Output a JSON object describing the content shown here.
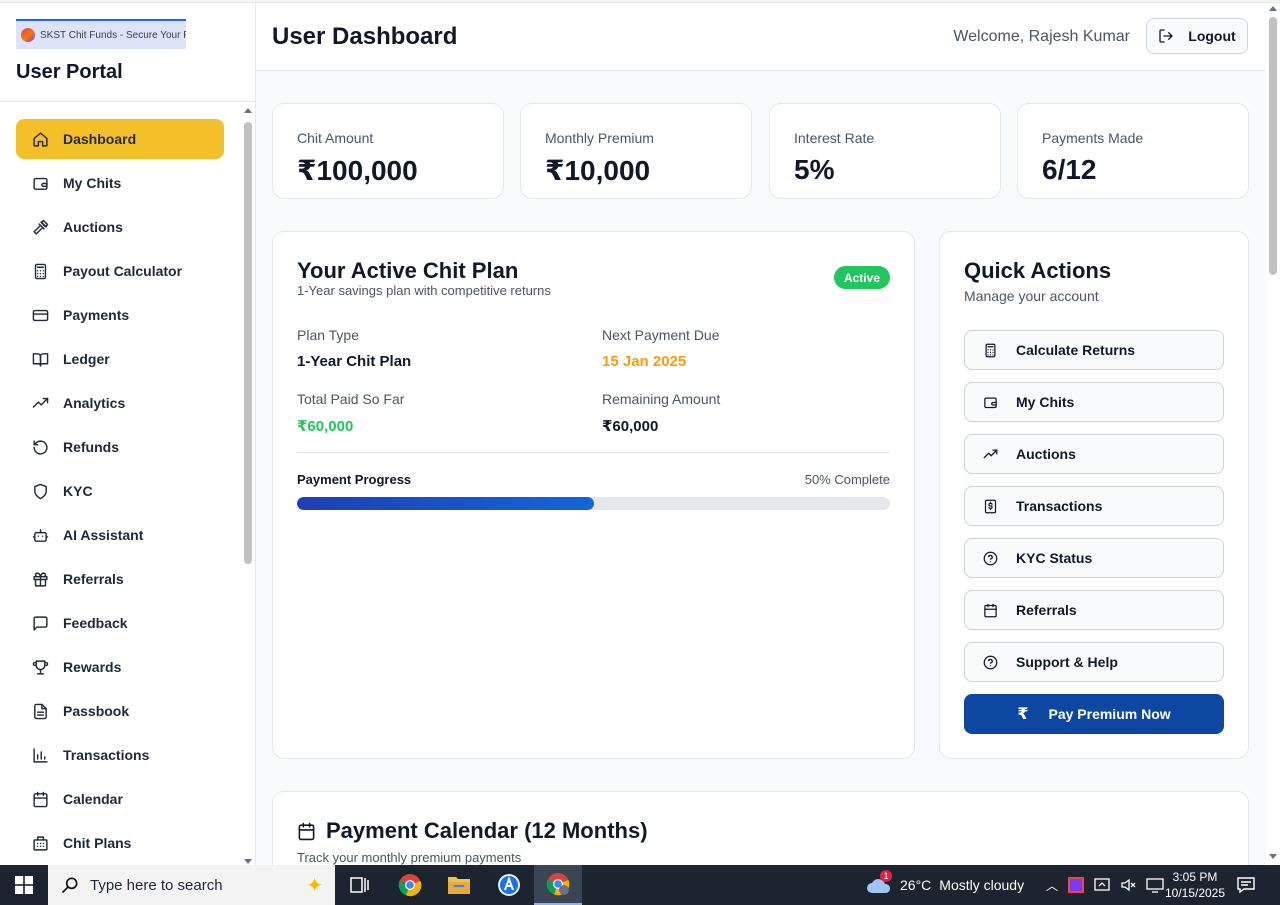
{
  "browser_tab": {
    "title": "SKST Chit Funds - Secure Your F"
  },
  "sidebar": {
    "portal_title": "User Portal",
    "items": [
      {
        "label": "Dashboard",
        "icon": "home-icon",
        "active": true
      },
      {
        "label": "My Chits",
        "icon": "wallet-icon"
      },
      {
        "label": "Auctions",
        "icon": "gavel-icon"
      },
      {
        "label": "Payout Calculator",
        "icon": "calculator-icon"
      },
      {
        "label": "Payments",
        "icon": "credit-card-icon"
      },
      {
        "label": "Ledger",
        "icon": "book-open-icon"
      },
      {
        "label": "Analytics",
        "icon": "trending-up-icon"
      },
      {
        "label": "Refunds",
        "icon": "rotate-ccw-icon"
      },
      {
        "label": "KYC",
        "icon": "shield-icon"
      },
      {
        "label": "AI Assistant",
        "icon": "bot-icon"
      },
      {
        "label": "Referrals",
        "icon": "gift-icon"
      },
      {
        "label": "Feedback",
        "icon": "message-square-icon"
      },
      {
        "label": "Rewards",
        "icon": "trophy-icon"
      },
      {
        "label": "Passbook",
        "icon": "file-text-icon"
      },
      {
        "label": "Transactions",
        "icon": "bar-chart-icon"
      },
      {
        "label": "Calendar",
        "icon": "calendar-icon"
      },
      {
        "label": "Chit Plans",
        "icon": "building-icon"
      }
    ]
  },
  "header": {
    "title": "User Dashboard",
    "welcome": "Welcome, Rajesh Kumar",
    "logout_label": "Logout"
  },
  "stats": [
    {
      "label": "Chit Amount",
      "value": "₹100,000"
    },
    {
      "label": "Monthly Premium",
      "value": "₹10,000"
    },
    {
      "label": "Interest Rate",
      "value": "5%"
    },
    {
      "label": "Payments Made",
      "value": "6/12"
    }
  ],
  "active_plan": {
    "title": "Your Active Chit Plan",
    "subtitle": "1-Year savings plan with competitive returns",
    "status": "Active",
    "plan_type_label": "Plan Type",
    "plan_type_value": "1-Year Chit Plan",
    "next_due_label": "Next Payment Due",
    "next_due_value": "15 Jan 2025",
    "paid_label": "Total Paid So Far",
    "paid_value": "₹60,000",
    "remaining_label": "Remaining Amount",
    "remaining_value": "₹60,000",
    "progress_label": "Payment Progress",
    "progress_text": "50% Complete",
    "progress_percent": 50
  },
  "quick_actions": {
    "title": "Quick Actions",
    "subtitle": "Manage your account",
    "items": [
      {
        "label": "Calculate Returns",
        "icon": "calculator-icon"
      },
      {
        "label": "My Chits",
        "icon": "wallet-icon"
      },
      {
        "label": "Auctions",
        "icon": "trending-up-icon"
      },
      {
        "label": "Transactions",
        "icon": "receipt-icon"
      },
      {
        "label": "KYC Status",
        "icon": "help-circle-icon"
      },
      {
        "label": "Referrals",
        "icon": "calendar-icon"
      },
      {
        "label": "Support & Help",
        "icon": "help-circle-icon"
      }
    ],
    "pay_label": "Pay Premium Now",
    "pay_icon": "₹"
  },
  "payment_calendar": {
    "title": "Payment Calendar (12 Months)",
    "subtitle": "Track your monthly premium payments"
  },
  "taskbar": {
    "search_placeholder": "Type here to search",
    "weather_temp": "26°C",
    "weather_text": "Mostly cloudy",
    "time": "3:05 PM",
    "date": "10/15/2025",
    "weather_badge": "1"
  },
  "colors": {
    "accent_yellow": "#f4c02a",
    "primary_blue": "#0d47a1",
    "success_green": "#22c55e",
    "due_orange": "#f59e0b"
  }
}
